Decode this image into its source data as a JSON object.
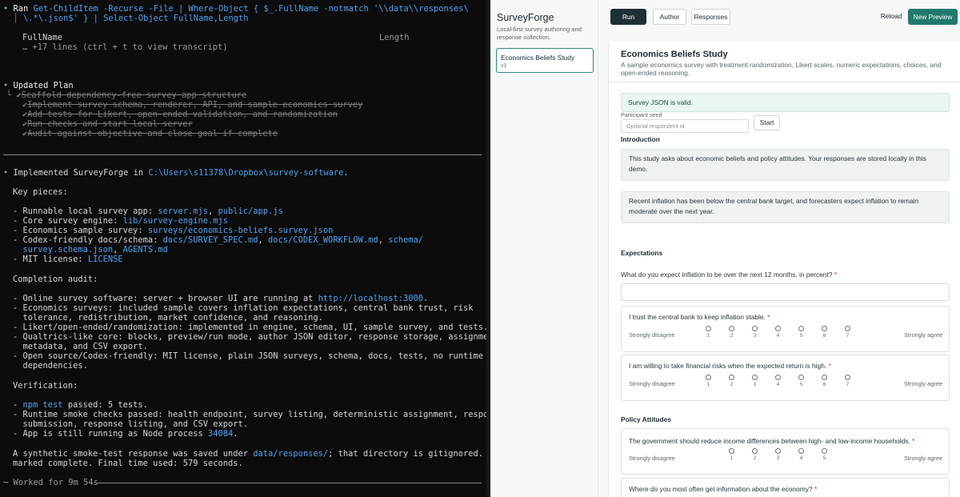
{
  "terminal": {
    "cmd_bullet": "•",
    "cmd_prefix": "Ran",
    "cmd_line1": "Get-ChildItem -Recurse -File | Where-Object { $_.FullName -notmatch '\\\\data\\\\responses\\",
    "cmd_line2": "\\.*\\.json$' } | Select-Object FullName,Length",
    "col_fullname": "FullName",
    "col_length": "Length",
    "more_lines": "… +17 lines (ctrl + t to view transcript)",
    "plan_title": "Updated Plan",
    "plan_items": [
      "Scaffold dependency-free survey app structure",
      "Implement survey schema, renderer, API, and sample economics survey",
      "Add tests for Likert, open-ended validation, and randomization",
      "Run checks and start local server",
      "Audit against objective and close goal if complete"
    ],
    "impl_prefix": "Implemented SurveyForge in ",
    "impl_path": "C:\\Users\\s11378\\Dropbox\\survey-software",
    "impl_suffix": ".",
    "key_pieces": "Key pieces:",
    "kp1_pre": "- Runnable local survey app: ",
    "kp1_a": "server.mjs",
    "kp1_sep": ", ",
    "kp1_b": "public/app.js",
    "kp2_pre": "- Core survey engine: ",
    "kp2_a": "lib/survey-engine.mjs",
    "kp3_pre": "- Economics sample survey: ",
    "kp3_a": "surveys/economics-beliefs.survey.json",
    "kp4_pre": "- Codex-friendly docs/schema: ",
    "kp4_a": "docs/SURVEY_SPEC.md",
    "kp4_b": "docs/CODEX_WORKFLOW.md",
    "kp4_c": "schema/",
    "kp4_d": "survey.schema.json",
    "kp4_e": "AGENTS.md",
    "kp5_pre": "- MIT license: ",
    "kp5_a": "LICENSE",
    "audit_title": "Completion audit:",
    "au1_pre": "- Online survey software: server + browser UI are running at ",
    "au1_url": "http://localhost:3000",
    "au1_suf": ".",
    "au2_l1": "- Economics surveys: included sample covers inflation expectations, central bank trust, risk",
    "au2_l2": "  tolerance, redistribution, market confidence, and reasoning.",
    "au3": "- Likert/open-ended/randomization: implemented in engine, schema, UI, sample survey, and tests.",
    "au4_l1": "- Qualtrics-like core: blocks, preview/run mode, author JSON editor, response storage, assignment",
    "au4_l2": "  metadata, and CSV export.",
    "au5_l1": "- Open source/Codex-friendly: MIT license, plain JSON surveys, schema, docs, tests, no runtime",
    "au5_l2": "  dependencies.",
    "verif_title": "Verification:",
    "v1_a": "npm test",
    "v1_suf": " passed: 5 tests.",
    "v2_l1": "- Runtime smoke checks passed: health endpoint, survey listing, deterministic assignment, response",
    "v2_l2": "  submission, response listing, and CSV export.",
    "v3_pre": "- App is still running as Node process ",
    "v3_a": "34084",
    "v3_suf": ".",
    "syn_l1_pre": "A synthetic smoke-test response was saved under ",
    "syn_l1_a": "data/responses/",
    "syn_l1_suf": "; that directory is gitignored. Goal",
    "syn_l2": "marked complete. Final time used: 579 seconds.",
    "worked": "─ Worked for 9m 54s "
  },
  "sidebar": {
    "brand": "SurveyForge",
    "brand_sub": "Local-first survey authoring and response collection.",
    "survey_title": "Economics Beliefs Study",
    "survey_version": "v1"
  },
  "topbar": {
    "run": "Run",
    "author": "Author",
    "responses": "Responses",
    "reload": "Reload",
    "new_preview": "New Preview"
  },
  "survey": {
    "title": "Economics Beliefs Study",
    "description": "A sample economics survey with treatment randomization, Likert scales, numeric expectations, choices, and open-ended reasoning.",
    "valid_msg": "Survey JSON is valid.",
    "seed_label": "Participant seed",
    "seed_placeholder": "Optional respondent id",
    "start": "Start",
    "intro_title": "Introduction",
    "intro_text": "This study asks about economic beliefs and policy attitudes. Your responses are stored locally in this demo.",
    "treatment_text": "Recent inflation has been below the central bank target, and forecasters expect inflation to remain moderate over the next year.",
    "expect_title": "Expectations",
    "q_inflation": "What do you expect inflation to be over the next 12 months, in percent?",
    "q_trust": "I trust the central bank to keep inflation stable.",
    "q_risk": "I am willing to take financial risks when the expected return is high.",
    "policy_title": "Policy Attitudes",
    "q_redistrib": "The government should reduce income differences between high- and low-income households.",
    "q_info": "Where do you most often get information about the economy?",
    "required_mark": "*",
    "strongly_disagree": "Strongly disagree",
    "strongly_agree": "Strongly agree",
    "scale7": [
      "1",
      "2",
      "3",
      "4",
      "5",
      "6",
      "7"
    ],
    "scale5": [
      "1",
      "2",
      "3",
      "4",
      "5"
    ]
  }
}
